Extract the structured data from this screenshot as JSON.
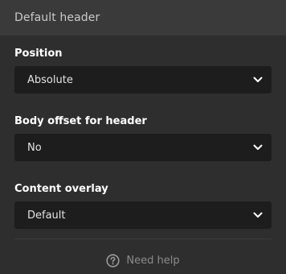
{
  "header": {
    "title": "Default header"
  },
  "fields": [
    {
      "label": "Position",
      "value": "Absolute"
    },
    {
      "label": "Body offset for header",
      "value": "No"
    },
    {
      "label": "Content overlay",
      "value": "Default"
    }
  ],
  "help": {
    "label": "Need help",
    "icon": "question-circle-icon"
  },
  "colors": {
    "panel_bg": "#2e2e2f",
    "header_bg": "#3a3a3b",
    "select_bg": "#1d1d1e",
    "label_text": "#ffffff",
    "muted_text": "#8b8b8b"
  }
}
